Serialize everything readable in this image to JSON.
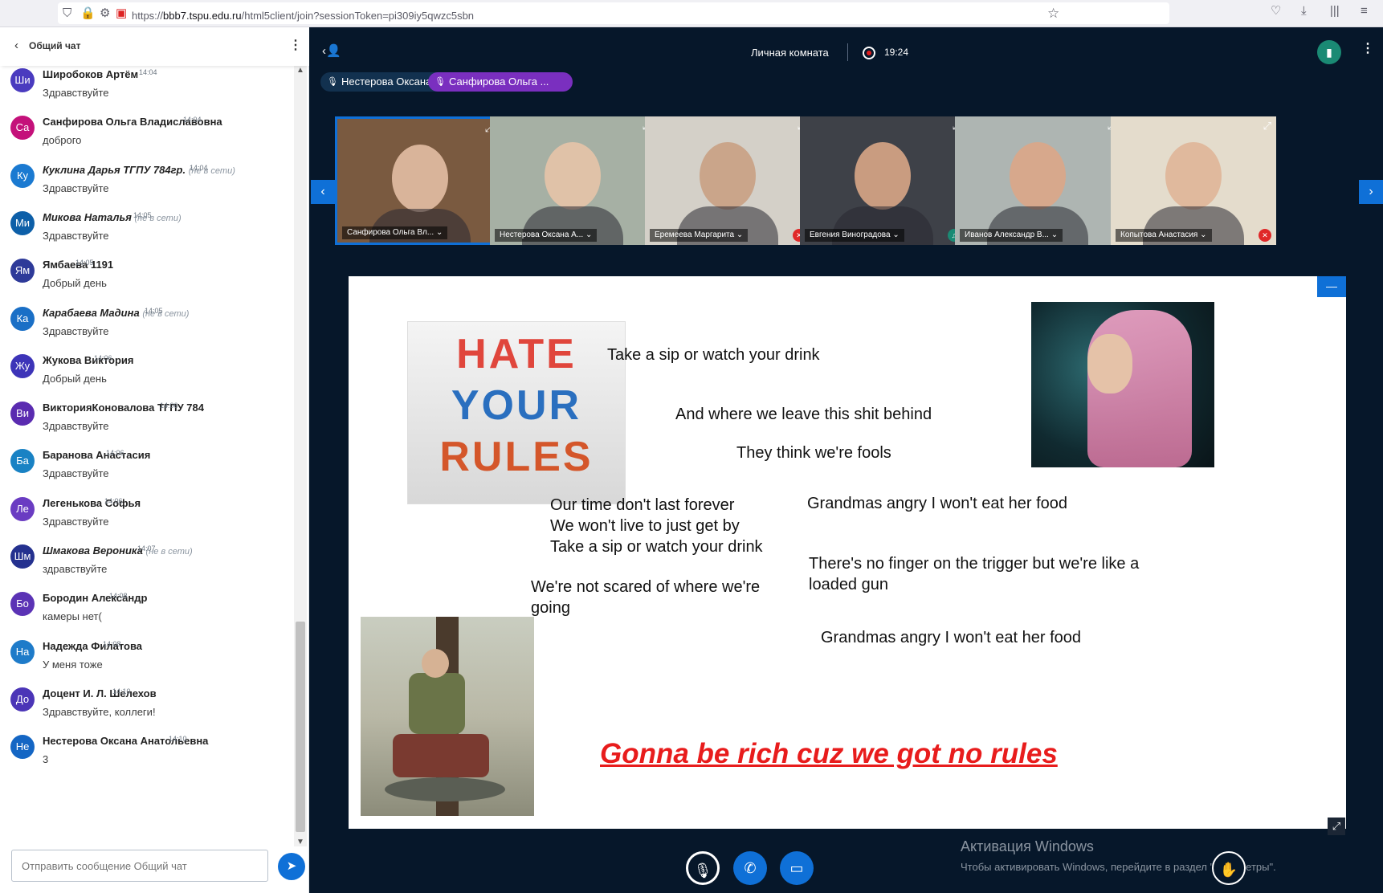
{
  "browser": {
    "url_protocol": "https://",
    "url_host": "bbb7.tspu.edu.ru",
    "url_path": "/html5client/join?sessionToken=pi309iy5qwzc5sbn"
  },
  "chat": {
    "title": "Общий чат",
    "input_placeholder": "Отправить сообщение Общий чат",
    "messages": [
      {
        "initials": "Ши",
        "name": "Широбоков Артём",
        "time": "14:04",
        "text": "Здравствуйте",
        "status": "",
        "color": "#4a3bbf"
      },
      {
        "initials": "Са",
        "name": "Санфирова Ольга Владиславовна",
        "time": "14:04",
        "text": "доброго",
        "status": "",
        "color": "#c4117a"
      },
      {
        "initials": "Ку",
        "name": "Куклина Дарья ТГПУ 784гр.",
        "time": "14:04",
        "text": "Здравствуйте",
        "status": "(не в сети)",
        "color": "#1b7ad1"
      },
      {
        "initials": "Ми",
        "name": "Микова Наталья",
        "time": "14:05",
        "text": "Здравствуйте",
        "status": "(не в сети)",
        "color": "#0d5fa8"
      },
      {
        "initials": "Ям",
        "name": "Ямбаева 1191",
        "time": "14:05",
        "text": "Добрый день",
        "status": "",
        "color": "#2e3a99"
      },
      {
        "initials": "Ка",
        "name": "Карабаева Мадина",
        "time": "14:05",
        "text": "Здравствуйте",
        "status": "(не в сети)",
        "color": "#1a6fc6"
      },
      {
        "initials": "Жу",
        "name": "Жукова Виктория",
        "time": "14:06",
        "text": "Добрый день",
        "status": "",
        "color": "#3d34b8"
      },
      {
        "initials": "Ви",
        "name": "ВикторияКоновалова ТГПУ 784",
        "time": "14:06",
        "text": "Здравствуйте",
        "status": "",
        "color": "#5a2bb0"
      },
      {
        "initials": "Ба",
        "name": "Баранова Анастасия",
        "time": "14:06",
        "text": "Здравствуйте",
        "status": "",
        "color": "#1982c4"
      },
      {
        "initials": "Ле",
        "name": "Легенькова Софья",
        "time": "14:06",
        "text": "Здравствуйте",
        "status": "",
        "color": "#6a3cc2"
      },
      {
        "initials": "Шм",
        "name": "Шмакова Вероника",
        "time": "14:07",
        "text": "здравствуйте",
        "status": "(не в сети)",
        "color": "#24318f"
      },
      {
        "initials": "Бо",
        "name": "Бородин Александр",
        "time": "14:08",
        "text": "камеры нет(",
        "status": "",
        "color": "#5b33b5"
      },
      {
        "initials": "На",
        "name": "Надежда Филатова",
        "time": "14:08",
        "text": "У меня тоже",
        "status": "",
        "color": "#1e7bc9"
      },
      {
        "initials": "До",
        "name": "Доцент И. Л. Шелехов",
        "time": "14:10",
        "text": "Здравствуйте, коллеги!",
        "status": "",
        "color": "#4b35b7"
      },
      {
        "initials": "Не",
        "name": "Нестерова Оксана Анатольевна",
        "time": "14:10",
        "text": "3",
        "status": "",
        "color": "#1466c4"
      }
    ]
  },
  "meeting": {
    "title": "Личная комната",
    "rec_time": "19:24"
  },
  "talking": [
    {
      "name": "Нестерова Оксана ...",
      "color": "#12314f"
    },
    {
      "name": "Санфирова Ольга ...",
      "color": "#7a2fbf"
    }
  ],
  "tiles": [
    {
      "name": "Санфирова Ольга Вл...",
      "active": true,
      "badge": "",
      "bg": "#7a5a40",
      "skin": "#d9b49a"
    },
    {
      "name": "Нестерова Оксана А...",
      "active": false,
      "badge": "",
      "bg": "#a6b0a4",
      "skin": "#e0c2a8"
    },
    {
      "name": "Еремеева Маргарита",
      "active": false,
      "badge": "muted",
      "bg": "#d4d0c8",
      "skin": "#caa58a"
    },
    {
      "name": "Евгения Виноградова",
      "active": false,
      "badge": "listen",
      "bg": "#3e4148",
      "skin": "#c99c80"
    },
    {
      "name": "Иванов Александр В...",
      "active": false,
      "badge": "",
      "bg": "#aeb5b2",
      "skin": "#d7a88c"
    },
    {
      "name": "Копытова Анастасия",
      "active": false,
      "badge": "muted",
      "bg": "#e4dccc",
      "skin": "#e0b99d"
    }
  ],
  "slide": {
    "hate_words": [
      "HATE",
      "YOUR",
      "RULES"
    ],
    "lyrics": {
      "l1": "Take a sip or watch your drink",
      "l2": "And where we leave this shit behind",
      "l3": "They think we're fools",
      "l4": "Our time don't last forever",
      "l5": "We won't live to just get by",
      "l6": "Take a sip or watch your drink",
      "l7": "Grandmas angry I won't eat her food",
      "l8": "There's no finger on the trigger but we're like a",
      "l9": "loaded gun",
      "l10": "We're not scared of where we're",
      "l11": "going",
      "l12": "Grandmas angry I won't eat her food"
    },
    "tagline": "Gonna be rich cuz we got no rules"
  },
  "windows_activation": {
    "title": "Активация Windows",
    "subtitle": "Чтобы активировать Windows, перейдите в раздел \"Параметры\"."
  },
  "colors": {
    "accent": "#0f70d7",
    "main_bg": "#06172a",
    "tagline": "#e81c1c"
  }
}
